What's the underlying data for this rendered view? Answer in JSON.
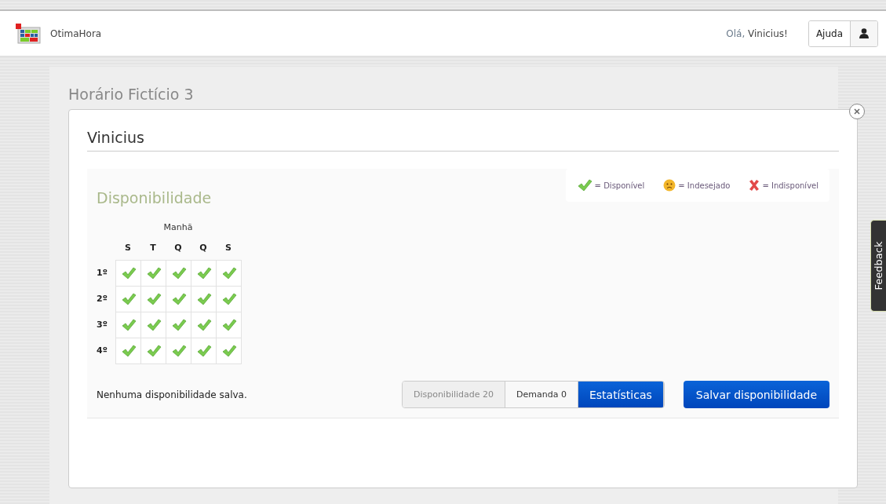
{
  "header": {
    "brand": "OtimaHora",
    "greeting": "Olá, ",
    "user": "Vinicius!",
    "help": "Ajuda"
  },
  "page_title": "Horário Fictício 3",
  "feedback": "Feedback",
  "modal": {
    "title": "Vinicius",
    "section_title": "Disponibilidade",
    "legend": [
      {
        "kind": "available",
        "label": "= Disponível"
      },
      {
        "kind": "unwanted",
        "label": "= Indesejado"
      },
      {
        "kind": "unavailable",
        "label": "= Indisponível"
      }
    ],
    "period": "Manhã",
    "days": [
      "S",
      "T",
      "Q",
      "Q",
      "S"
    ],
    "rows": [
      {
        "label": "1º",
        "cells": [
          {
            "kind": "available"
          },
          {
            "kind": "available"
          },
          {
            "kind": "available"
          },
          {
            "kind": "available"
          },
          {
            "kind": "available"
          }
        ]
      },
      {
        "label": "2º",
        "cells": [
          {
            "kind": "available"
          },
          {
            "kind": "available"
          },
          {
            "kind": "available"
          },
          {
            "kind": "available"
          },
          {
            "kind": "available"
          }
        ]
      },
      {
        "label": "3º",
        "cells": [
          {
            "kind": "available"
          },
          {
            "kind": "available"
          },
          {
            "kind": "available"
          },
          {
            "kind": "available"
          },
          {
            "kind": "available"
          }
        ]
      },
      {
        "label": "4º",
        "cells": [
          {
            "kind": "available"
          },
          {
            "kind": "available"
          },
          {
            "kind": "available"
          },
          {
            "kind": "available"
          },
          {
            "kind": "available"
          }
        ]
      }
    ],
    "status": "Nenhuma disponibilidade salva.",
    "stats": [
      {
        "label": "Disponibilidade 20",
        "selected": false,
        "kind": "muted"
      },
      {
        "label": "Demanda 0",
        "selected": false,
        "kind": "plain"
      },
      {
        "label": "Estatísticas",
        "selected": true,
        "kind": "primary"
      }
    ],
    "save": "Salvar disponibilidade"
  }
}
